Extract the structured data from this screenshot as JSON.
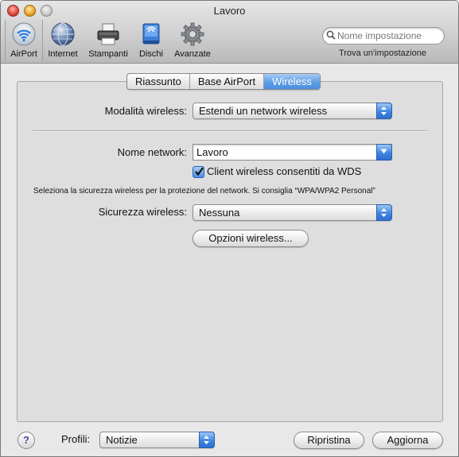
{
  "window": {
    "title": "Lavoro"
  },
  "toolbar": {
    "items": [
      {
        "label": "AirPort",
        "icon": "airport-icon"
      },
      {
        "label": "Internet",
        "icon": "internet-icon"
      },
      {
        "label": "Stampanti",
        "icon": "printer-icon"
      },
      {
        "label": "Dischi",
        "icon": "disk-icon"
      },
      {
        "label": "Avanzate",
        "icon": "gear-icon"
      }
    ],
    "search_placeholder": "Nome impostazione",
    "search_caption": "Trova un'impostazione"
  },
  "tabs": [
    "Riassunto",
    "Base AirPort",
    "Wireless"
  ],
  "active_tab": "Wireless",
  "form": {
    "wireless_mode_label": "Modalità wireless:",
    "wireless_mode_value": "Estendi un network wireless",
    "network_name_label": "Nome network:",
    "network_name_value": "Lavoro",
    "wds_checkbox_label": "Client wireless consentiti da WDS",
    "wds_checked": true,
    "security_hint": "Seleziona la sicurezza wireless per la protezione del network. Si consiglia “WPA/WPA2 Personal”",
    "security_label": "Sicurezza wireless:",
    "security_value": "Nessuna",
    "options_button": "Opzioni wireless..."
  },
  "footer": {
    "help": "?",
    "profiles_label": "Profili:",
    "profiles_value": "Notizie",
    "revert_button": "Ripristina",
    "update_button": "Aggiorna"
  },
  "colors": {
    "accent": "#3f86e2",
    "tab_active": "#5e9ee6"
  }
}
